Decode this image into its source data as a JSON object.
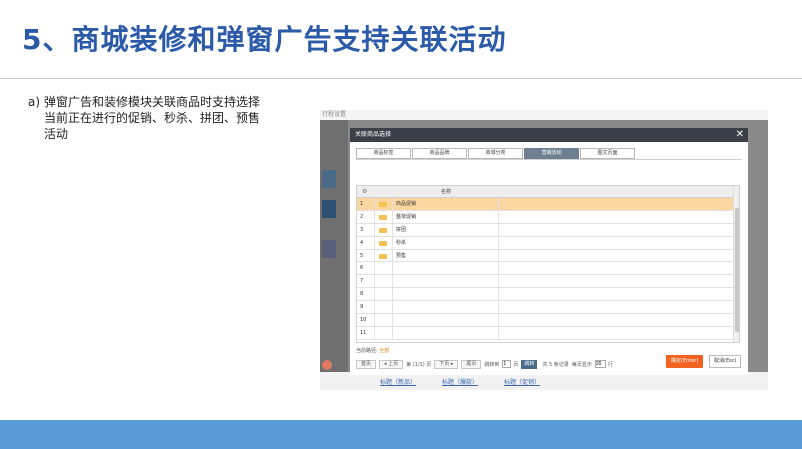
{
  "slide": {
    "title": "5、商城装修和弹窗广告支持关联活动",
    "bullet_marker": "a)",
    "bullet_text": "弹窗广告和装修模块关联商品时支持选择当前正在进行的促销、秒杀、拼团、预售活动"
  },
  "background_app": {
    "top_text": "行程设置",
    "footer_links": [
      "标题（新品）",
      "标题（爆款）",
      "标题（促销）"
    ]
  },
  "modal": {
    "title": "关联商品选择",
    "close_icon": "close-icon",
    "tabs": [
      {
        "label": "商品标签"
      },
      {
        "label": "商品品牌"
      },
      {
        "label": "商城分类"
      },
      {
        "label": "营销活动",
        "active": true
      },
      {
        "label": "图文页面"
      }
    ],
    "grid": {
      "gear_icon": "⚙",
      "name_header": "名称",
      "rows": [
        {
          "num": "1",
          "name": "商品促销",
          "folder": true
        },
        {
          "num": "2",
          "name": "整单促销",
          "folder": true
        },
        {
          "num": "3",
          "name": "拼团",
          "folder": true
        },
        {
          "num": "4",
          "name": "秒杀",
          "folder": true
        },
        {
          "num": "5",
          "name": "预售",
          "folder": true
        },
        {
          "num": "6",
          "name": "",
          "folder": false
        },
        {
          "num": "7",
          "name": "",
          "folder": false
        },
        {
          "num": "8",
          "name": "",
          "folder": false
        },
        {
          "num": "9",
          "name": "",
          "folder": false
        },
        {
          "num": "10",
          "name": "",
          "folder": false
        },
        {
          "num": "11",
          "name": "",
          "folder": false
        }
      ]
    },
    "path": {
      "label": "当前路径:",
      "value": "全部"
    },
    "pager": {
      "first": "首页",
      "prev": "◂ 上页",
      "info": "第 (1/1) 页",
      "next": "下页 ▸",
      "last": "尾页",
      "jump_label": "跳转到",
      "jump_value": "1",
      "jump_unit": "页",
      "go": "跳转",
      "total": "共 5 条记录",
      "per_page_label": "每页显示",
      "per_page_value": "20",
      "per_page_unit": "行"
    },
    "ok_label": "确定(Enter)",
    "cancel_label": "取消(Esc)"
  }
}
